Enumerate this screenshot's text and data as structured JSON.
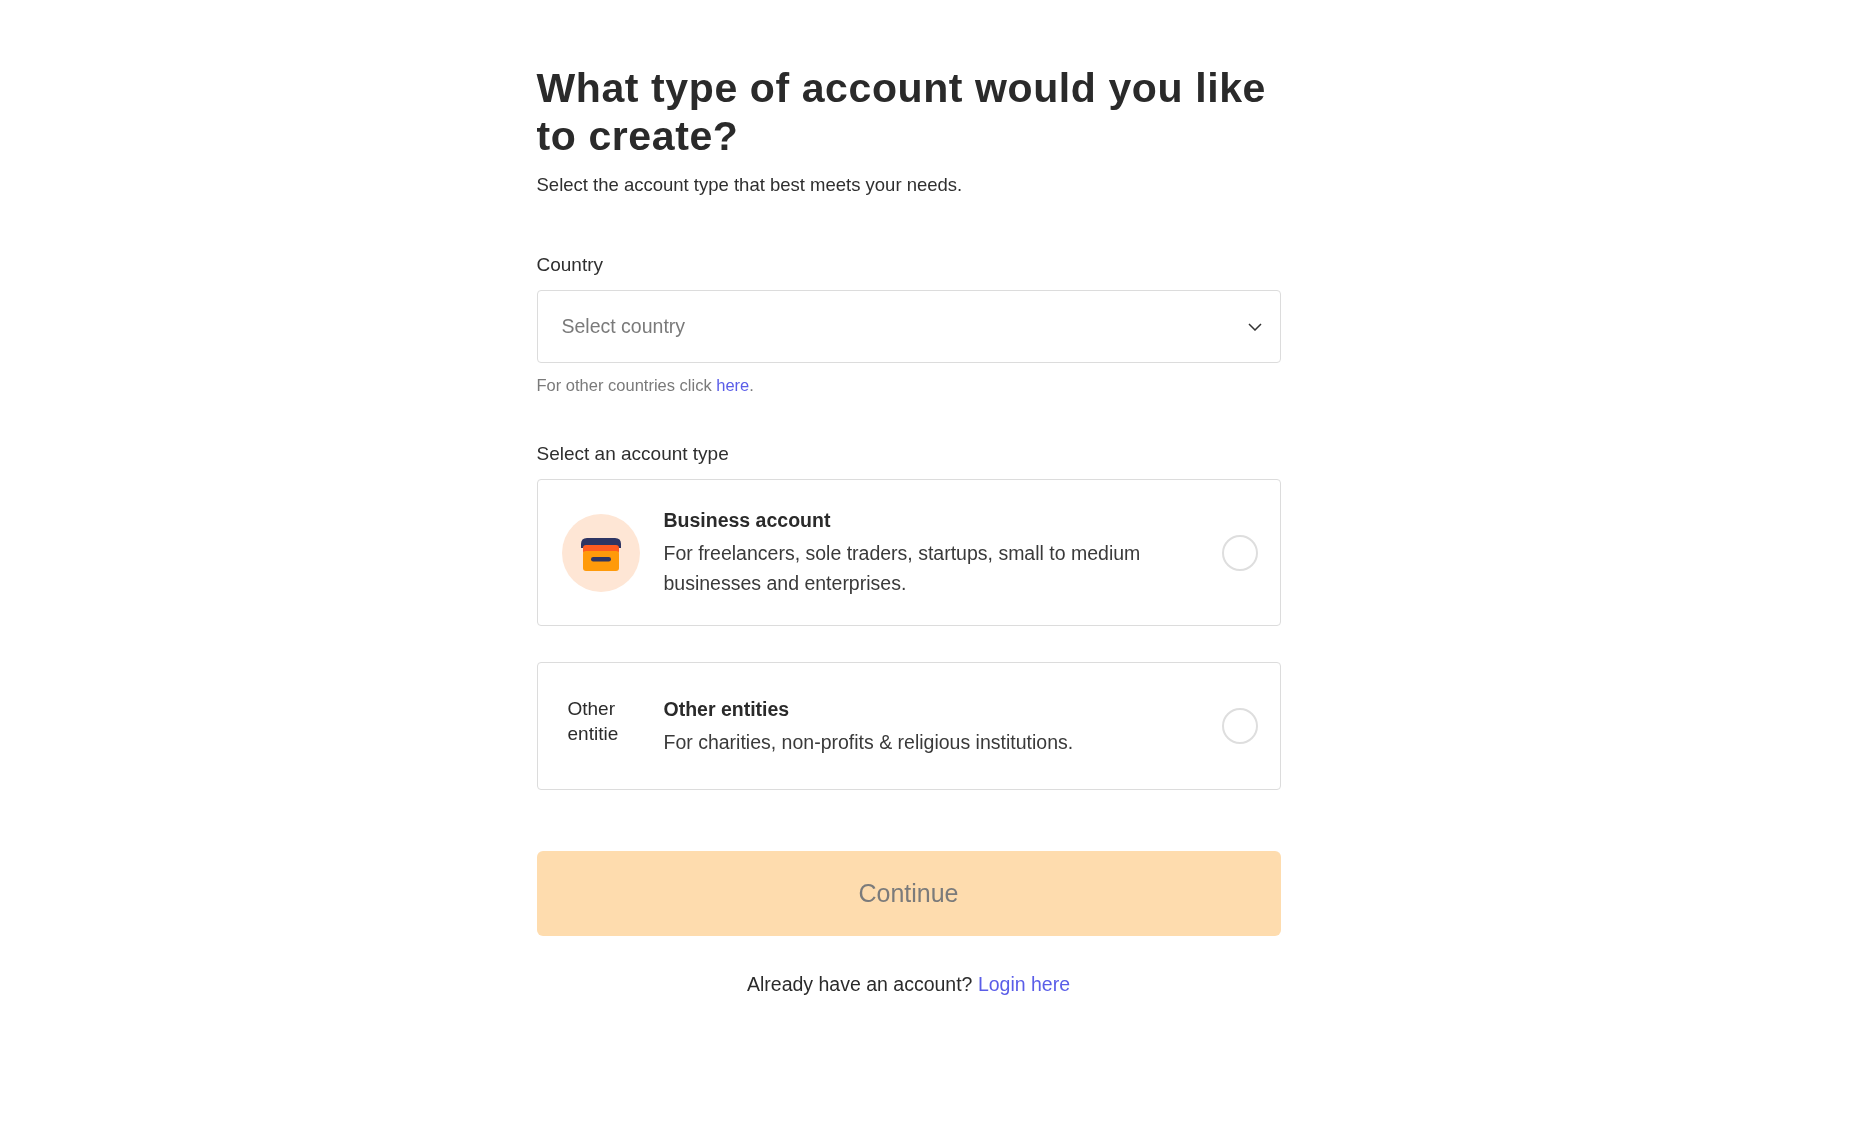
{
  "heading": {
    "title": "What type of account would you like to create?",
    "subtitle": "Select the account type that best meets your needs."
  },
  "country": {
    "label": "Country",
    "placeholder": "Select country",
    "hint": {
      "text": "For other countries click",
      "link": "here",
      "end": "."
    }
  },
  "account_types": {
    "label": "Select an account type",
    "options": [
      {
        "kind": "icon",
        "title": "Business account",
        "description": "For freelancers, sole traders, startups, small to medium businesses and enterprises.",
        "selected": false
      },
      {
        "kind": "alt_text",
        "image_alt": "Other entitie",
        "title": "Other entities",
        "description": "For charities, non-profits & religious institutions.",
        "selected": false
      }
    ]
  },
  "continue_button": {
    "label": "Continue",
    "disabled": true
  },
  "login": {
    "text": "Already have an account?",
    "link": "Login here"
  }
}
